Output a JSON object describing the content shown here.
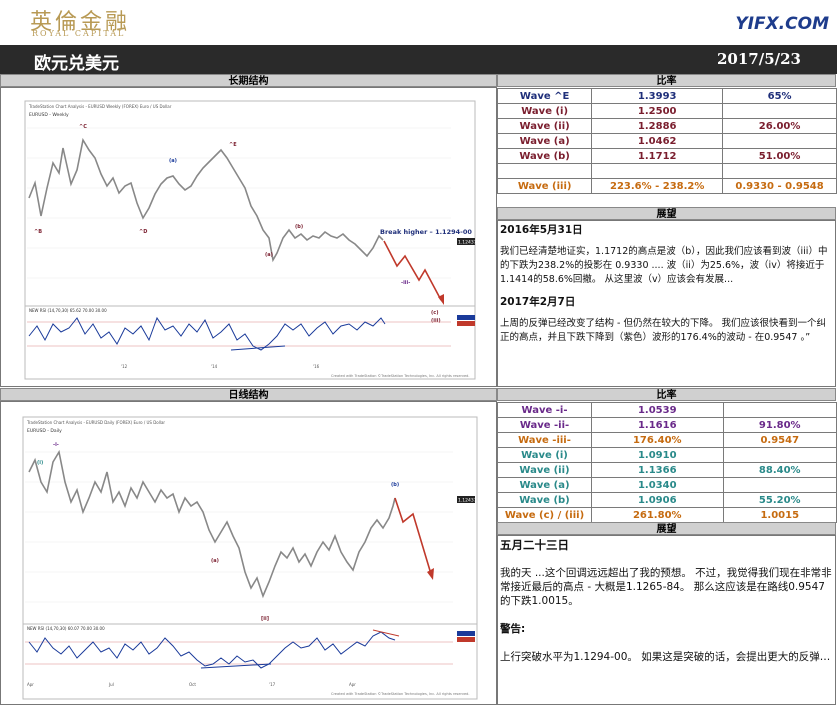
{
  "header": {
    "logo_cn": "英倫金融",
    "logo_en": "ROYAL CAPITAL",
    "site": "YIFX.COM",
    "title": "欧元兑美元",
    "date": "2017/5/23"
  },
  "top": {
    "chart_title": "长期结构",
    "ratio_title": "比率",
    "outlook_title": "展望",
    "chart_header": "TradeStation Chart Analysis - EURUSD Weekly (FOREX) Euro / US Dollar",
    "chart_symbol": "EURUSD - Weekly",
    "breakout_label": "Break higher – 1.1294-00",
    "price_tag": "1.12437",
    "rsi_label": "NEW RSI (14,70,30)  65.62  70.00  30.00",
    "footer": "Created with TradeStation ©TradeStation Technologies, Inc. All rights reserved.",
    "rows": [
      {
        "label": "Wave ^E",
        "value": "1.3993",
        "pct": "65%",
        "cls": "navy"
      },
      {
        "label": "Wave (i)",
        "value": "1.2500",
        "pct": "",
        "cls": "maroon"
      },
      {
        "label": "Wave (ii)",
        "value": "1.2886",
        "pct": "26.00%",
        "cls": "maroon"
      },
      {
        "label": "Wave (a)",
        "value": "1.0462",
        "pct": "",
        "cls": "maroon"
      },
      {
        "label": "Wave (b)",
        "value": "1.1712",
        "pct": "51.00%",
        "cls": "maroon"
      },
      {
        "label": "",
        "value": "",
        "pct": "",
        "cls": "maroon"
      },
      {
        "label": "Wave (iii)",
        "value": "223.6% - 238.2%",
        "pct": "0.9330 - 0.9548",
        "cls": "orange"
      }
    ],
    "text_date1": "2016年5月31日",
    "text_p1": "我们已经清楚地证实，1.1712的高点是波（b），因此我们应该看到波（iii）中的下跌为238.2%的投影在 0.9330 .... 波（ii）为25.6%，波（iv）将接近于1.1414的58.6%回撤。 从这里波（v）应该会有发展...",
    "text_date2": "2017年2月7日",
    "text_p2": "上周的反弹已经改变了结构 - 但仍然在较大的下降。 我们应该很快看到一个纠正的高点，并且下跌下降到（紫色）波形的176.4%的波动 - 在0.9547 。”"
  },
  "bottom": {
    "chart_title": "日线结构",
    "ratio_title": "比率",
    "outlook_title": "展望",
    "chart_header": "TradeStation Chart Analysis - EURUSD Daily (FOREX) Euro / US Dollar",
    "chart_symbol": "EURUSD - Daily",
    "price_tag": "1.12437",
    "rsi_label": "NEW RSI (14,70,30)  60.07  70.00  30.00",
    "footer": "Created with TradeStation ©TradeStation Technologies, Inc. All rights reserved.",
    "rows": [
      {
        "label": "Wave -i-",
        "value": "1.0539",
        "pct": "",
        "cls": "purple"
      },
      {
        "label": "Wave -ii-",
        "value": "1.1616",
        "pct": "91.80%",
        "cls": "purple"
      },
      {
        "label": "Wave -iii-",
        "value": "176.40%",
        "pct": "0.9547",
        "cls": "orange"
      },
      {
        "label": "Wave (i)",
        "value": "1.0910",
        "pct": "",
        "cls": "teal"
      },
      {
        "label": "Wave (ii)",
        "value": "1.1366",
        "pct": "88.40%",
        "cls": "teal"
      },
      {
        "label": "Wave (a)",
        "value": "1.0340",
        "pct": "",
        "cls": "teal"
      },
      {
        "label": "Wave (b)",
        "value": "1.0906",
        "pct": "55.20%",
        "cls": "teal"
      },
      {
        "label": "Wave (c) / (iii)",
        "value": "261.80%",
        "pct": "1.0015",
        "cls": "orange"
      }
    ],
    "text_date": "五月二十三日",
    "text_p1": "我的天 ...这个回调远远超出了我的预想。 不过，我觉得我们现在非常非常接近最后的高点 - 大概是1.1265-84。 那么这应该是在路线0.9547的下跌1.0015。",
    "warn": "警告:",
    "text_p2": "上行突破水平为1.1294-00。 如果这是突破的话，会提出更大的反弹…"
  }
}
